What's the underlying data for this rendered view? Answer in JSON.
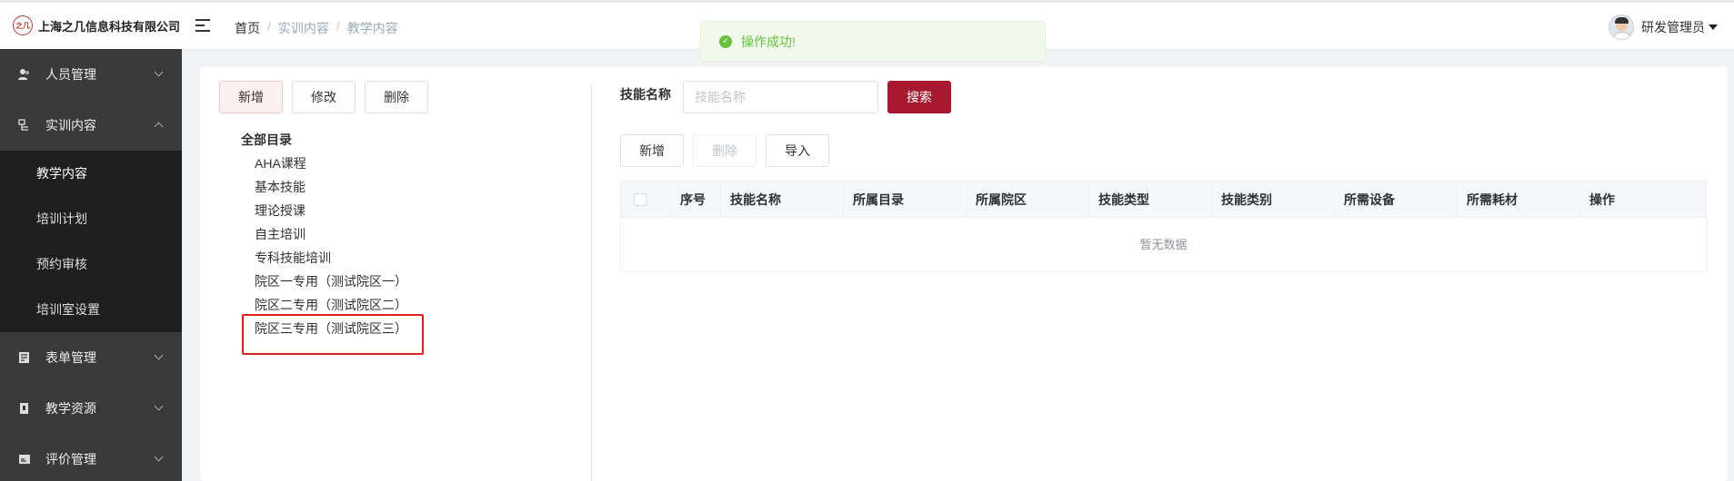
{
  "header": {
    "company": "上海之几信息科技有限公司",
    "logo_mark": "之几",
    "breadcrumb": [
      "首页",
      "实训内容",
      "教学内容"
    ],
    "user_name": "研发管理员"
  },
  "toast": {
    "message": "操作成功!",
    "color": "#67c23a"
  },
  "sidebar": {
    "items": [
      {
        "label": "人员管理",
        "icon": "users-icon"
      },
      {
        "label": "实训内容",
        "icon": "content-icon"
      },
      {
        "label": "表单管理",
        "icon": "form-icon"
      },
      {
        "label": "教学资源",
        "icon": "resource-icon"
      },
      {
        "label": "评价管理",
        "icon": "evaluation-icon"
      }
    ],
    "sub_items": [
      "教学内容",
      "培训计划",
      "预约审核",
      "培训室设置"
    ]
  },
  "tree_toolbar": {
    "add": "新增",
    "edit": "修改",
    "delete": "删除"
  },
  "tree": {
    "root": "全部目录",
    "nodes": [
      "AHA课程",
      "基本技能",
      "理论授课",
      "自主培训",
      "专科技能培训",
      "院区一专用（测试院区一）",
      "院区二专用（测试院区二）",
      "院区三专用（测试院区三）"
    ]
  },
  "search": {
    "label": "技能名称",
    "placeholder": "技能名称",
    "button": "搜索"
  },
  "table_toolbar": {
    "add": "新增",
    "delete": "删除",
    "import": "导入"
  },
  "table": {
    "columns": [
      "序号",
      "技能名称",
      "所属目录",
      "所属院区",
      "技能类型",
      "技能类别",
      "所需设备",
      "所需耗材",
      "操作"
    ],
    "empty_text": "暂无数据"
  },
  "colors": {
    "accent": "#a8182f",
    "sidebar": "#3a3a3a",
    "highlight_box": "#e02020"
  }
}
